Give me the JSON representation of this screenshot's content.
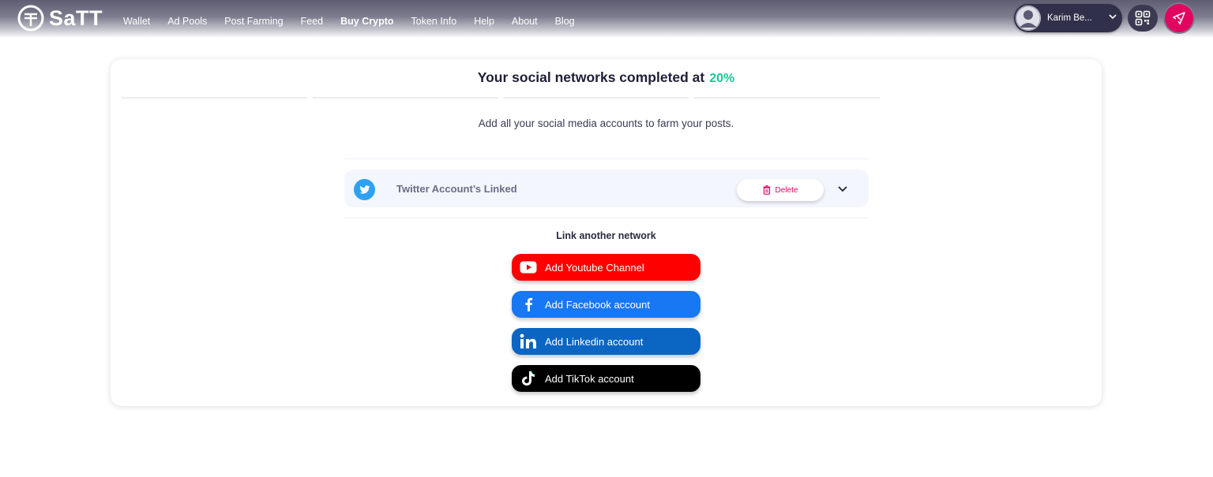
{
  "header": {
    "logo_text": "SaTT",
    "nav": [
      "Wallet",
      "Ad Pools",
      "Post Farming",
      "Feed",
      "Buy Crypto",
      "Token Info",
      "Help",
      "About",
      "Blog"
    ],
    "active_nav": "Buy Crypto",
    "user_name": "Karim Be...",
    "icons": [
      "user-avatar-icon",
      "chevron-down-icon",
      "qr-code-icon",
      "rocket-icon"
    ]
  },
  "card": {
    "headline": "Your social networks completed at",
    "completion_percent": "20%",
    "completion_value": 0.2,
    "subtitle": "Add all your social media accounts to farm your posts.",
    "linked": {
      "label": "Twitter Account’s Linked",
      "delete_label": "Delete"
    },
    "link_another": "Link another network",
    "buttons": {
      "youtube": "Add Youtube Channel",
      "facebook": "Add Facebook account",
      "linkedin": "Add Linkedin account",
      "tiktok": "Add TikTok account"
    }
  },
  "colors": {
    "accent_green": "#1bc79a",
    "brand_pink": "#e10560",
    "youtube": "#ff0000",
    "facebook": "#1877f2",
    "linkedin": "#0a66c2",
    "tiktok": "#000000",
    "twitter": "#2fa1f2"
  }
}
